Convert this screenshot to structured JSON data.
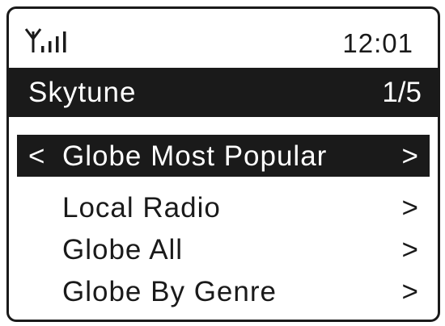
{
  "status": {
    "time": "12:01",
    "signal_icon": "signal-strength-icon"
  },
  "header": {
    "title": "Skytune",
    "page": "1/5"
  },
  "menu": {
    "left_arrow": "<",
    "items": [
      {
        "label": "Globe Most Popular",
        "arrow": ">"
      },
      {
        "label": "Local Radio",
        "arrow": ">"
      },
      {
        "label": "Globe All",
        "arrow": ">"
      },
      {
        "label": "Globe By Genre",
        "arrow": ">"
      }
    ]
  },
  "colors": {
    "foreground": "#1a1a1a",
    "background": "#ffffff"
  }
}
